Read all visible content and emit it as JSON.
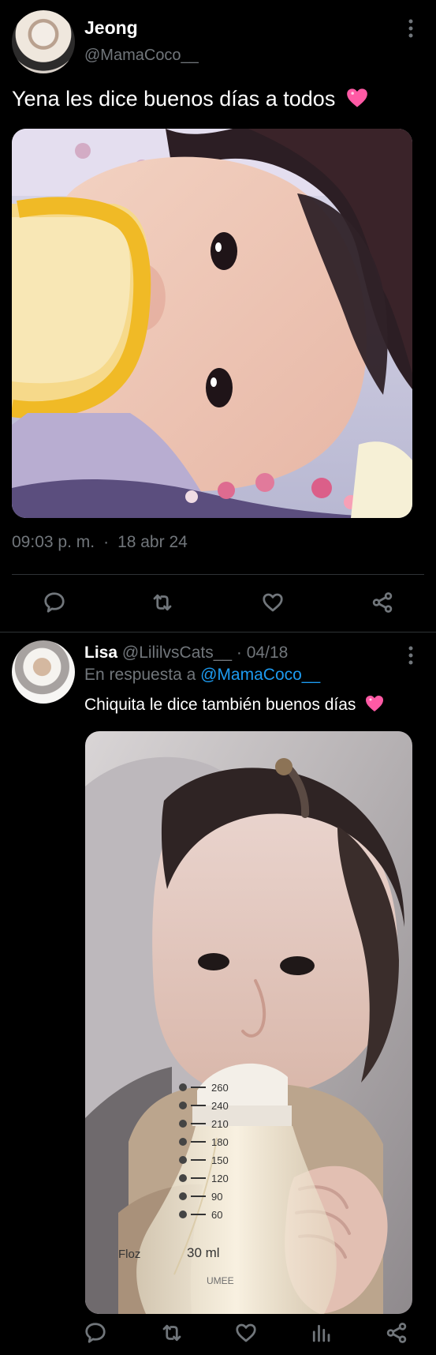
{
  "main_post": {
    "display_name": "Jeong",
    "handle": "@MamaCoco__",
    "text": "Yena les dice buenos días a todos",
    "time": "09:03 p. m.",
    "separator": "·",
    "date": "18 abr 24",
    "avatar_icon": "avatar-image",
    "more_icon": "more-vertical-icon",
    "heart_emoji_color": "#ff5aa5"
  },
  "reply_post": {
    "display_name": "Lisa",
    "handle": "@LililvsCats__",
    "date_prefix": "· 04/18",
    "reply_prefix": "En respuesta a",
    "reply_mention": "@MamaCoco__",
    "text": "Chiquita le dice también buenos días",
    "avatar_icon": "avatar-image",
    "heart_emoji_color": "#ff5aa5"
  },
  "bottle": {
    "unit_label": "Floz",
    "ml_label": "30 ml",
    "brand_label": "UMEE",
    "marks": [
      "260",
      "240",
      "210",
      "180",
      "150",
      "120",
      "90",
      "60"
    ]
  },
  "actions": {
    "main": [
      "reply-icon",
      "repost-icon",
      "like-icon",
      "share-icon"
    ],
    "reply": [
      "reply-icon",
      "repost-icon",
      "like-icon",
      "views-icon",
      "share-icon"
    ]
  },
  "colors": {
    "background": "#000000",
    "primary_text": "#ffffff",
    "secondary_text": "#71767b",
    "link": "#1d9bf0",
    "divider": "#2f3336"
  }
}
